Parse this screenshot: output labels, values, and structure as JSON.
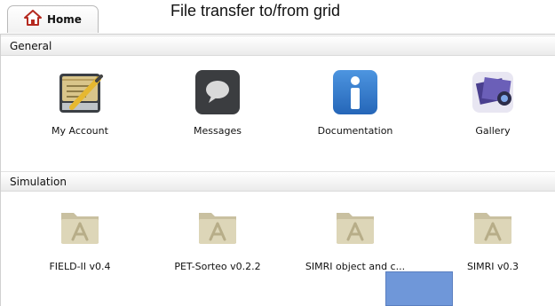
{
  "tab": {
    "label": "Home",
    "icon": "home-icon"
  },
  "title": "File transfer to/from grid",
  "sections": [
    {
      "header": "General",
      "items": [
        {
          "label": "My Account",
          "icon": "my-account-icon"
        },
        {
          "label": "Messages",
          "icon": "messages-icon"
        },
        {
          "label": "Documentation",
          "icon": "info-icon"
        },
        {
          "label": "Gallery",
          "icon": "gallery-icon"
        }
      ]
    },
    {
      "header": "Simulation",
      "items": [
        {
          "label": "FIELD-II v0.4",
          "icon": "app-folder-icon"
        },
        {
          "label": "PET-Sorteo v0.2.2",
          "icon": "app-folder-icon"
        },
        {
          "label": "SIMRI object and c...",
          "icon": "app-folder-icon"
        },
        {
          "label": "SIMRI v0.3",
          "icon": "app-folder-icon"
        }
      ]
    }
  ],
  "colors": {
    "home_roof": "#c0392b",
    "info_blue": "#2f77c8",
    "overlay_box": "#6f97d9"
  }
}
